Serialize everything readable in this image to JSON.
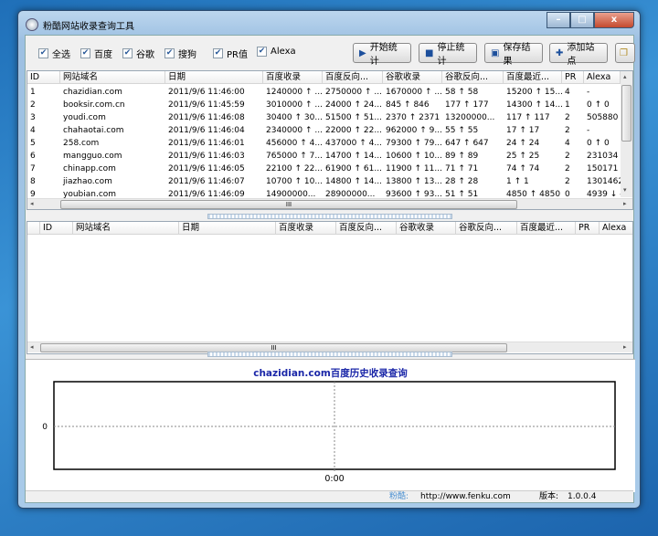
{
  "window": {
    "title": "粉酷网站收录查询工具",
    "min": "–",
    "max": "□",
    "close": "x"
  },
  "toolbar": {
    "checkboxes": [
      {
        "label": "全选",
        "checked": true
      },
      {
        "label": "百度",
        "checked": true
      },
      {
        "label": "谷歌",
        "checked": true
      },
      {
        "label": "搜狗",
        "checked": true
      },
      {
        "label": "PR值",
        "checked": true
      },
      {
        "label": "Alexa",
        "checked": true
      }
    ],
    "buttons": [
      {
        "label": "开始统计",
        "icon": "play-icon"
      },
      {
        "label": "停止统计",
        "icon": "stop-icon"
      },
      {
        "label": "保存结果",
        "icon": "save-icon"
      },
      {
        "label": "添加站点",
        "icon": "plus-icon"
      }
    ],
    "check_mark": "✔"
  },
  "table1": {
    "columns": [
      "ID",
      "网站域名",
      "日期",
      "百度收录",
      "百度反向...",
      "谷歌收录",
      "谷歌反向...",
      "百度最近...",
      "PR",
      "Alexa"
    ],
    "rows": [
      [
        "1",
        "chazidian.com",
        "2011/9/6 11:46:00",
        "1240000 ↑ ...",
        "2750000 ↑ ...",
        "1670000 ↑ ...",
        "58 ↑ 58",
        "15200 ↑ 15...",
        "4",
        "-"
      ],
      [
        "2",
        "booksir.com.cn",
        "2011/9/6 11:45:59",
        "3010000 ↑ ...",
        "24000 ↑ 24...",
        "845 ↑ 846",
        "177 ↑ 177",
        "14300 ↑ 14...",
        "1",
        "0 ↑ 0"
      ],
      [
        "3",
        "youdi.com",
        "2011/9/6 11:46:08",
        "30400 ↑ 30...",
        "51500 ↑ 51...",
        "2370 ↑ 2371",
        "13200000...",
        "117 ↑ 117",
        "2",
        "505880 ↓"
      ],
      [
        "4",
        "chahaotai.com",
        "2011/9/6 11:46:04",
        "2340000 ↑ ...",
        "22000 ↑ 22...",
        "962000 ↑ 9...",
        "55 ↑ 55",
        "17 ↑ 17",
        "2",
        "-"
      ],
      [
        "5",
        "258.com",
        "2011/9/6 11:46:01",
        "456000 ↑ 4...",
        "437000 ↑ 4...",
        "79300 ↑ 79...",
        "647 ↑ 647",
        "24 ↑ 24",
        "4",
        "0 ↑ 0"
      ],
      [
        "6",
        "mangguo.com",
        "2011/9/6 11:46:03",
        "765000 ↑ 7...",
        "14700 ↑ 14...",
        "10600 ↑ 10...",
        "89 ↑ 89",
        "25 ↑ 25",
        "2",
        "231034 ↓"
      ],
      [
        "7",
        "chinapp.com",
        "2011/9/6 11:46:05",
        "22100 ↑ 22...",
        "61900 ↑ 61...",
        "11900 ↑ 11...",
        "71 ↑ 71",
        "74 ↑ 74",
        "2",
        "150171 ↓"
      ],
      [
        "8",
        "jiazhao.com",
        "2011/9/6 11:46:07",
        "10700 ↑ 10...",
        "14800 ↑ 14...",
        "13800 ↑ 13...",
        "28 ↑ 28",
        "1 ↑ 1",
        "2",
        "1301462"
      ],
      [
        "9",
        "youbian.com",
        "2011/9/6 11:46:09",
        "14900000...",
        "28900000...",
        "93600 ↑ 93...",
        "51 ↑ 51",
        "4850 ↑ 4850",
        "0",
        "4939 ↓ -"
      ]
    ]
  },
  "table2": {
    "columns": [
      "ID",
      "网站域名",
      "日期",
      "百度收录",
      "百度反向...",
      "谷歌收录",
      "谷歌反向...",
      "百度最近...",
      "PR",
      "Alexa"
    ]
  },
  "scroll": {
    "grip": "III",
    "left": "◂",
    "right": "▸",
    "up": "▴",
    "down": "▾"
  },
  "chart_data": {
    "type": "line",
    "title": "chazidian.com百度历史收录查询",
    "x": [],
    "y": [],
    "xticks": [
      "0:00"
    ],
    "yticks": [
      "0"
    ],
    "xlabel": "",
    "ylabel": "",
    "grid": true
  },
  "status": {
    "brand_label": "粉酷:",
    "url": "http://www.fenku.com",
    "version_label": "版本:",
    "version": "1.0.0.4"
  }
}
